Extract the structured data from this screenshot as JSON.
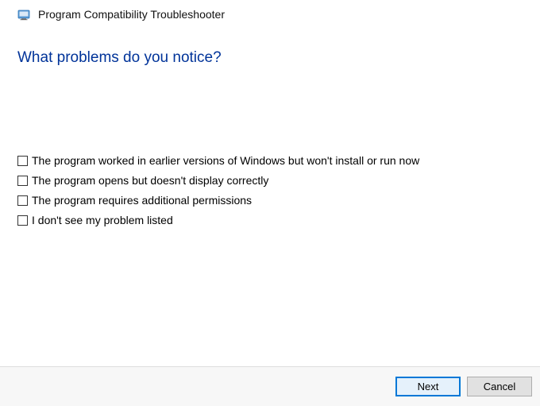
{
  "header": {
    "title": "Program Compatibility Troubleshooter"
  },
  "main": {
    "heading": "What problems do you notice?",
    "options": [
      {
        "label": "The program worked in earlier versions of Windows but won't install or run now"
      },
      {
        "label": "The program opens but doesn't display correctly"
      },
      {
        "label": "The program requires additional permissions"
      },
      {
        "label": "I don't see my problem listed"
      }
    ]
  },
  "footer": {
    "next_label": "Next",
    "cancel_label": "Cancel"
  }
}
